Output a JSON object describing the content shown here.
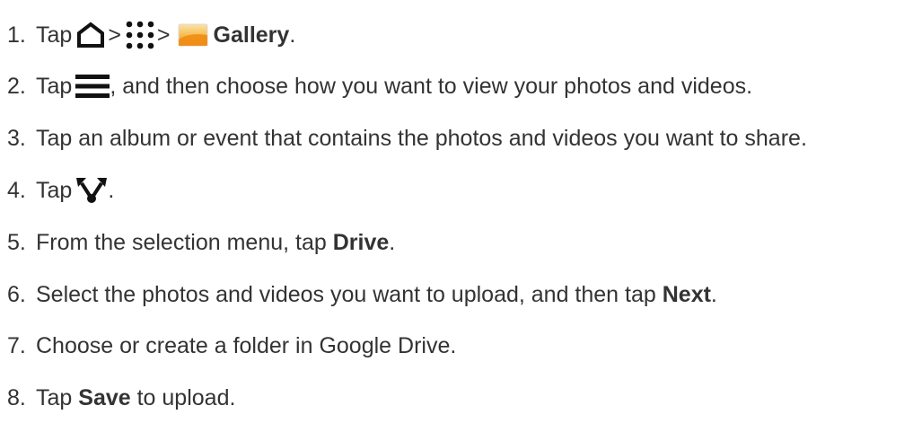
{
  "steps": [
    {
      "number": "1.",
      "tap": "Tap",
      "sep1": ">",
      "sep2": ">",
      "gallery": "Gallery",
      "end": ".",
      "icons": [
        "home-icon",
        "apps-grid-icon",
        "gallery-app-icon"
      ]
    },
    {
      "number": "2.",
      "tap": "Tap",
      "rest": ", and then choose how you want to view your photos and videos.",
      "icons": [
        "menu-icon"
      ]
    },
    {
      "number": "3.",
      "text": "Tap an album or event that contains the photos and videos you want to share."
    },
    {
      "number": "4.",
      "tap": "Tap",
      "end": ".",
      "icons": [
        "share-icon"
      ]
    },
    {
      "number": "5.",
      "pre": "From the selection menu, tap ",
      "bold": "Drive",
      "end": "."
    },
    {
      "number": "6.",
      "pre": "Select the photos and videos you want to upload, and then tap ",
      "bold": "Next",
      "end": "."
    },
    {
      "number": "7.",
      "text": "Choose or create a folder in Google Drive."
    },
    {
      "number": "8.",
      "pre": "Tap ",
      "bold": "Save",
      "post": " to upload."
    }
  ],
  "colors": {
    "text": "#333333",
    "icon": "#111111",
    "gallery_top": "#f9d68a",
    "gallery_bottom": "#f39a1f"
  }
}
